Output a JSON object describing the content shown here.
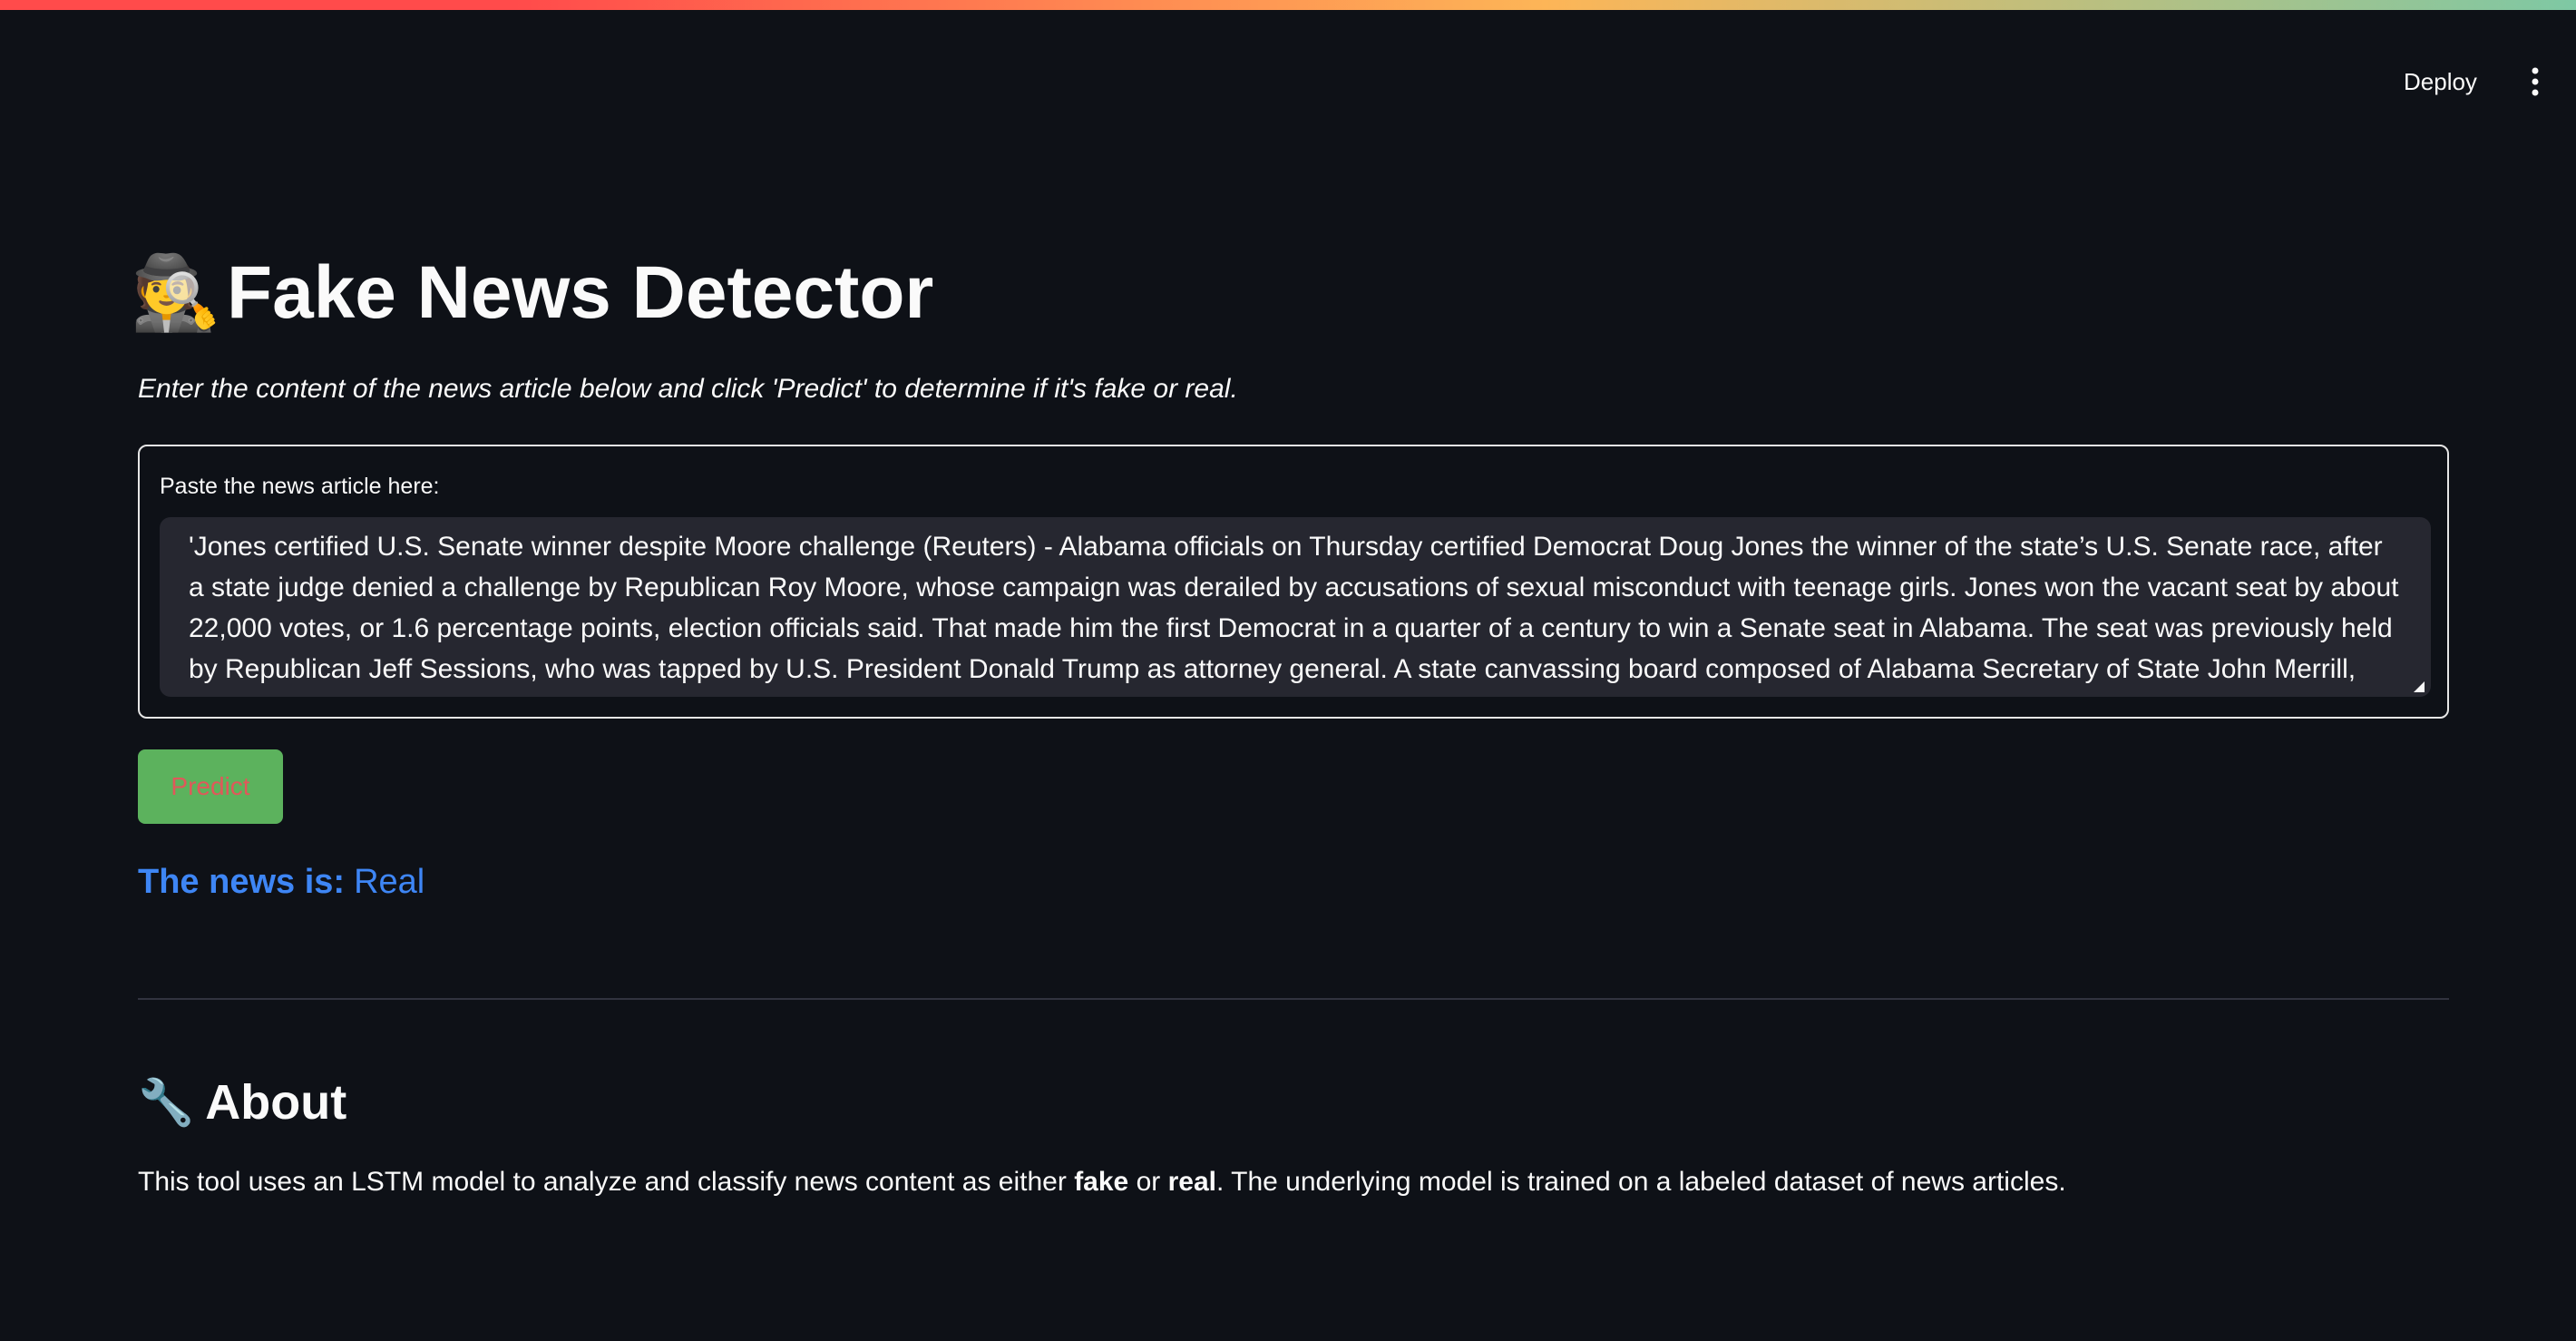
{
  "header": {
    "deploy_label": "Deploy",
    "menu_icon": "kebab-menu-icon"
  },
  "main": {
    "title_emoji": "🕵️",
    "title": "Fake News Detector",
    "subtitle": "Enter the content of the news article below and click 'Predict' to determine if it's fake or real.",
    "form": {
      "label": "Paste the news article here:",
      "value": "'Jones certified U.S. Senate winner despite Moore challenge (Reuters) - Alabama officials on Thursday certified Democrat Doug Jones the winner of the state’s U.S. Senate race, after a state judge denied a challenge by Republican Roy Moore, whose campaign was derailed by accusations of sexual misconduct with teenage girls. Jones won the vacant seat by about 22,000 votes, or 1.6 percentage points, election officials said. That made him the first Democrat in a quarter of a century to win a Senate seat in Alabama.  The seat was previously held by Republican Jeff Sessions, who was tapped by U.S. President Donald Trump as attorney general. A state canvassing board composed of Alabama Secretary of State John Merrill, Governor Kay Ivey and Attorney General Steve Marshall certified the election results. Seating Jones will narrow the Republican majority in the Senate to 51 of 100 seats. In a statement"
    },
    "predict_label": "Predict",
    "result": {
      "prefix": "The news is:",
      "value": "Real"
    },
    "about": {
      "icon": "🔧",
      "heading": "About",
      "text_1": "This tool uses an LSTM model to analyze and classify news content as either ",
      "bold_1": "fake",
      "text_2": " or ",
      "bold_2": "real",
      "text_3": ". The underlying model is trained on a labeled dataset of news articles."
    }
  },
  "colors": {
    "background": "#0e1117",
    "textarea_bg": "#262730",
    "predict_bg": "#5cb25d",
    "predict_text": "#e0585a",
    "result_blue": "#3e86f5"
  }
}
